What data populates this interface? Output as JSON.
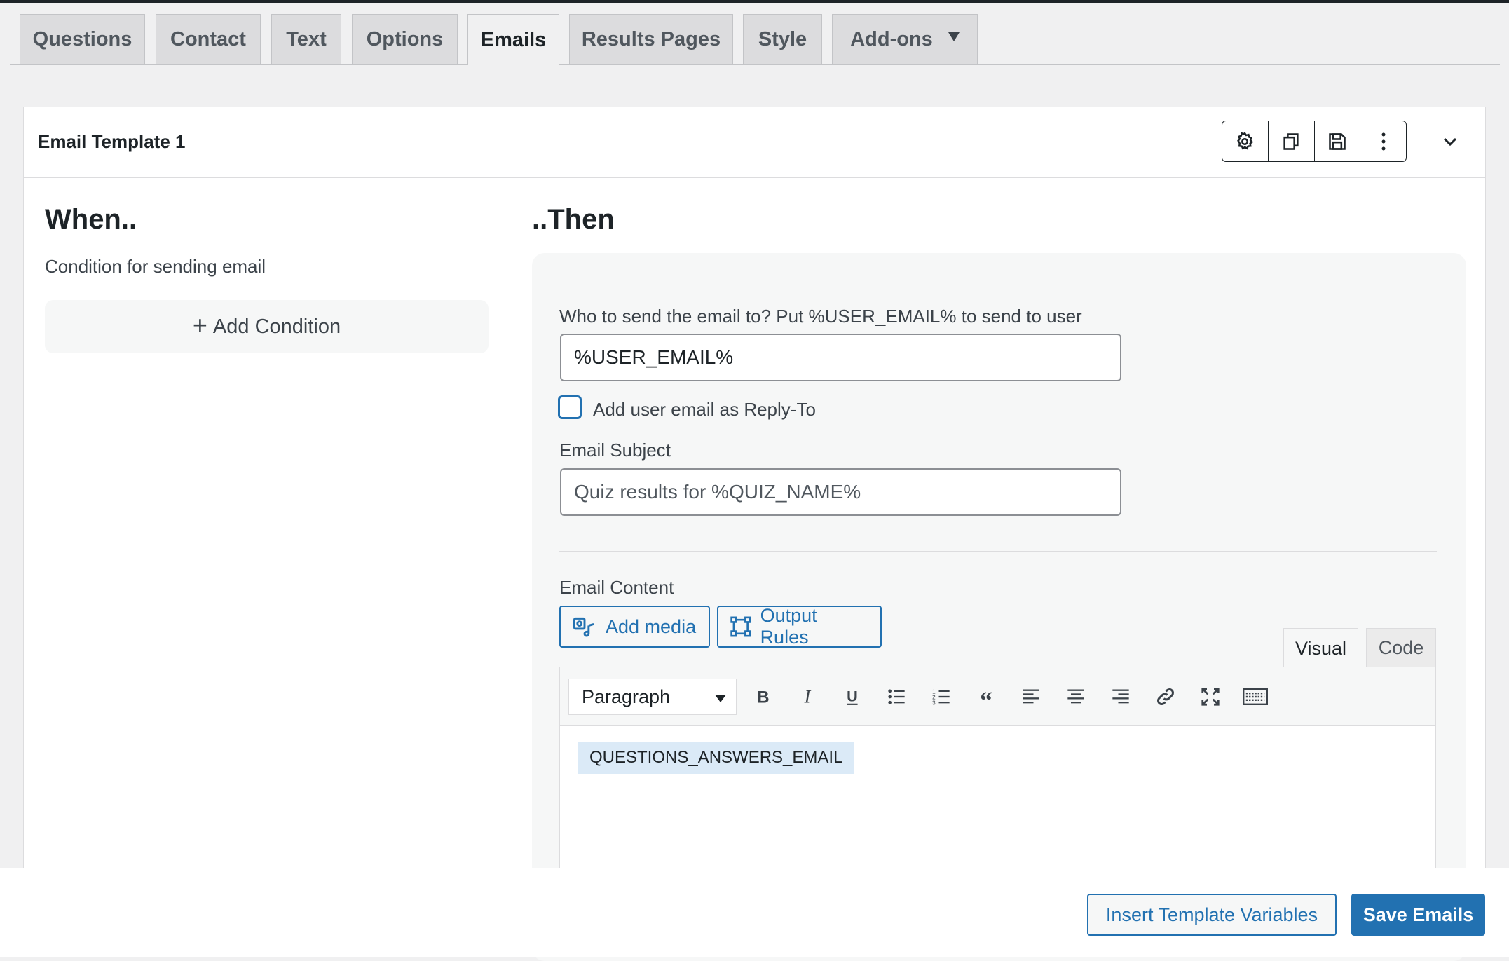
{
  "tabs": [
    {
      "label": "Questions"
    },
    {
      "label": "Contact"
    },
    {
      "label": "Text"
    },
    {
      "label": "Options"
    },
    {
      "label": "Emails",
      "active": true
    },
    {
      "label": "Results Pages"
    },
    {
      "label": "Style"
    },
    {
      "label": "Add-ons",
      "dropdown": true
    }
  ],
  "template": {
    "title": "Email Template 1",
    "header_icons": [
      "gear-icon",
      "duplicate-icon",
      "save-icon",
      "more-vertical-icon"
    ],
    "collapse_icon": "chevron-down-icon"
  },
  "when": {
    "title": "When..",
    "subtitle": "Condition for sending email",
    "add_condition_label": "Add Condition",
    "add_condition_icon": "plus-icon"
  },
  "then": {
    "title": "..Then",
    "recipient_label": "Who to send the email to? Put %USER_EMAIL% to send to user",
    "recipient_value": "%USER_EMAIL%",
    "reply_to_label": "Add user email as Reply-To",
    "reply_to_checked": false,
    "subject_label": "Email Subject",
    "subject_placeholder": "Quiz results for %QUIZ_NAME%",
    "content_label": "Email Content",
    "add_media_label": "Add media",
    "output_rules_label": "Output Rules",
    "editor_tabs": {
      "visual": "Visual",
      "code": "Code"
    },
    "format_selected": "Paragraph",
    "toolbar_icons": [
      "bold-icon",
      "italic-icon",
      "underline-icon",
      "bullet-list-icon",
      "numbered-list-icon",
      "blockquote-icon",
      "align-left-icon",
      "align-center-icon",
      "align-right-icon",
      "link-icon",
      "fullscreen-icon",
      "keyboard-icon"
    ],
    "content_text": "QUESTIONS_ANSWERS_EMAIL"
  },
  "footer": {
    "insert_variables_label": "Insert Template Variables",
    "save_label": "Save Emails"
  },
  "colors": {
    "accent": "#2271b1",
    "content_highlight": "#dbeaf7",
    "background": "#f0f0f1"
  }
}
